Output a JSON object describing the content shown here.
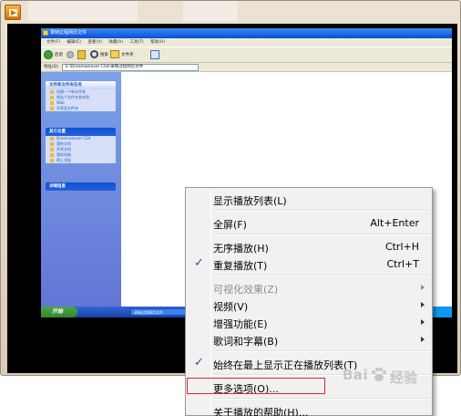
{
  "player": {
    "icon": "media-player-icon"
  },
  "embedded_screen": {
    "window_title": "录制过程网页文件",
    "menu": [
      "文件(F)",
      "编辑(E)",
      "查看(V)",
      "收藏(A)",
      "工具(T)",
      "帮助(H)"
    ],
    "toolbar": {
      "back_label": "后退",
      "search_label": "搜索",
      "folders_label": "文件夹"
    },
    "address_label": "地址(D)",
    "address_value": "E:\\Dreamweaver CS4\\录制过程网页文件",
    "panels": [
      {
        "title": "文件和文件夹任务",
        "items": [
          "创建一个新文件夹",
          "将这个文件夹发布到",
          "Web",
          "共享此文件夹"
        ]
      },
      {
        "title": "其它位置",
        "items": [
          "Dreamweaver CS4",
          "我的文档",
          "共享文档",
          "我的电脑",
          "网上邻居"
        ]
      },
      {
        "title": "详细信息",
        "items": []
      }
    ],
    "start_label": "开始",
    "taskbar_item": "录制过程网页文件"
  },
  "context_menu": {
    "items": [
      {
        "label": "显示播放列表(L)",
        "shortcut": "",
        "checked": false,
        "submenu": false,
        "disabled": false
      },
      {
        "label": "全屏(F)",
        "shortcut": "Alt+Enter",
        "checked": false,
        "submenu": false,
        "disabled": false
      },
      {
        "label": "无序播放(H)",
        "shortcut": "Ctrl+H",
        "checked": false,
        "submenu": false,
        "disabled": false
      },
      {
        "label": "重复播放(T)",
        "shortcut": "Ctrl+T",
        "checked": true,
        "submenu": false,
        "disabled": false
      },
      {
        "label": "可视化效果(Z)",
        "shortcut": "",
        "checked": false,
        "submenu": true,
        "disabled": true
      },
      {
        "label": "视频(V)",
        "shortcut": "",
        "checked": false,
        "submenu": true,
        "disabled": false
      },
      {
        "label": "增强功能(E)",
        "shortcut": "",
        "checked": false,
        "submenu": true,
        "disabled": false
      },
      {
        "label": "歌词和字幕(B)",
        "shortcut": "",
        "checked": false,
        "submenu": true,
        "disabled": false
      },
      {
        "label": "始终在最上显示正在播放列表(T)",
        "shortcut": "",
        "checked": true,
        "submenu": false,
        "disabled": false
      },
      {
        "label": "更多选项(O)...",
        "shortcut": "",
        "checked": false,
        "submenu": false,
        "disabled": false
      },
      {
        "label": "关于播放的帮助(H)...",
        "shortcut": "",
        "checked": false,
        "submenu": false,
        "disabled": false
      }
    ],
    "highlight_color": "#d42c2c"
  },
  "watermark": {
    "text": "Bai",
    "suffix": "经验"
  }
}
